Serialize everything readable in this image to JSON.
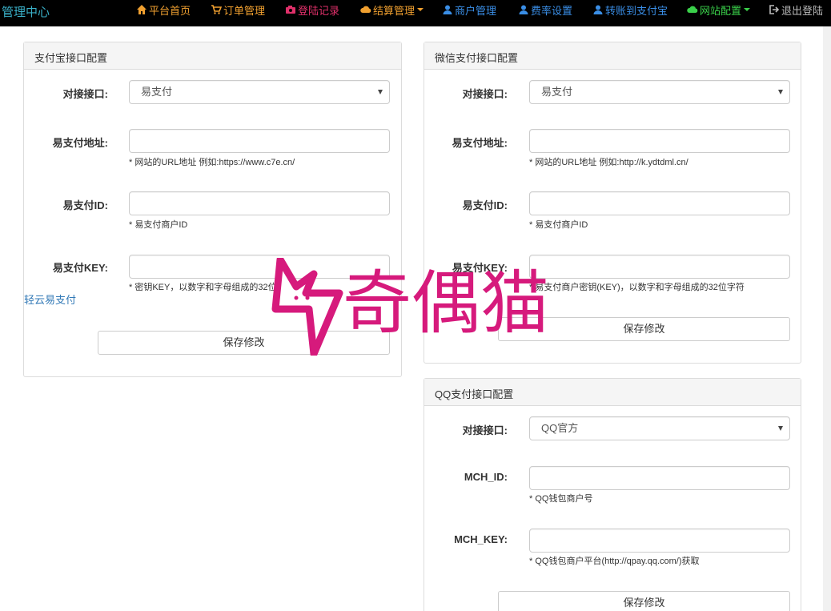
{
  "nav": {
    "brand": "管理中心",
    "items": [
      {
        "label": "平台首页",
        "icon": "home-icon",
        "color": "#f0a030"
      },
      {
        "label": "订单管理",
        "icon": "cart-icon",
        "color": "#f0a030"
      },
      {
        "label": "登陆记录",
        "icon": "camera-icon",
        "color": "#e0306a"
      },
      {
        "label": "结算管理",
        "icon": "cloud-icon",
        "color": "#f0a030"
      },
      {
        "label": "商户管理",
        "icon": "user-icon",
        "color": "#3a8ee6"
      },
      {
        "label": "费率设置",
        "icon": "user-icon",
        "color": "#3a8ee6"
      },
      {
        "label": "转账到支付宝",
        "icon": "user-icon",
        "color": "#3a8ee6"
      },
      {
        "label": "网站配置",
        "icon": "cloud-icon",
        "color": "#3ad04a"
      },
      {
        "label": "退出登陆",
        "icon": "logout-icon",
        "color": "#bbbbbb"
      }
    ]
  },
  "alipay": {
    "title": "支付宝接口配置",
    "api_label": "对接接口:",
    "api_value": "易支付",
    "url_label": "易支付地址:",
    "url_value": "",
    "url_help": "* 网站的URL地址 例如:https://www.c7e.cn/",
    "id_label": "易支付ID:",
    "id_value": "",
    "id_help": "* 易支付商户ID",
    "key_label": "易支付KEY:",
    "key_value": "",
    "key_help": "* 密钥KEY，以数字和字母组成的32位字符",
    "save": "保存修改"
  },
  "left_link": "轻云易支付",
  "wechat": {
    "title": "微信支付接口配置",
    "api_label": "对接接口:",
    "api_value": "易支付",
    "url_label": "易支付地址:",
    "url_value": "",
    "url_help": "* 网站的URL地址 例如:http://k.ydtdml.cn/",
    "id_label": "易支付ID:",
    "id_value": "",
    "id_help": "* 易支付商户ID",
    "key_label": "易支付KEY:",
    "key_value": "",
    "key_help": "* 易支付商户密钥(KEY)，以数字和字母组成的32位字符",
    "save": "保存修改"
  },
  "qq": {
    "title": "QQ支付接口配置",
    "api_label": "对接接口:",
    "api_value": "QQ官方",
    "mchid_label": "MCH_ID:",
    "mchid_value": "",
    "mchid_help": "* QQ钱包商户号",
    "mchkey_label": "MCH_KEY:",
    "mchkey_value": "",
    "mchkey_help": "* QQ钱包商户平台(http://qpay.qq.com/)获取",
    "save": "保存修改"
  },
  "watermark": {
    "text": "奇偶猫",
    "color": "#d61a7c"
  }
}
